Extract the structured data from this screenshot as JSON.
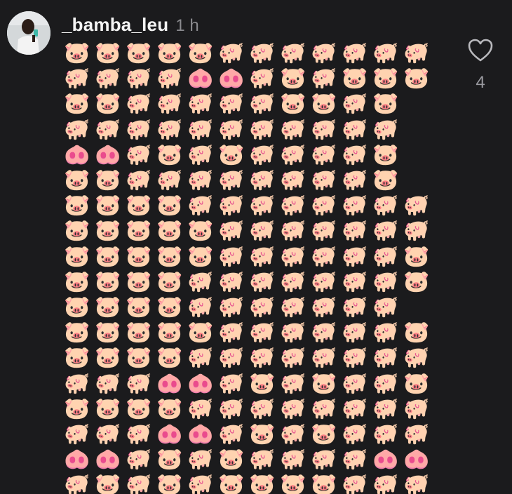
{
  "post": {
    "username": "_bamba_leu",
    "timestamp": "1 h"
  },
  "likes": {
    "count": "4",
    "icon": "heart-icon"
  },
  "emoji_legend": {
    "F": "🐷",
    "P": "🐖",
    "N": "🐽"
  },
  "emoji_rows": [
    "FFFFFPPPPPPP",
    "PPPPNNPFPFFF",
    "FFPPPPPFFPF",
    "PPPPPPPPPPP",
    "NNPFPFPPPPF",
    "FFPPPPPPPPF",
    "FFFFPPPPPPPP",
    "FFFFFPPPPPPP",
    "FFFFFPPPPPPF",
    "FFFFPPPPPPPF",
    "FFFFPPPPPPP",
    "FFFFFPPPPPPF",
    "FFFFPPPPPPPP",
    "PPPNNPFPFPPF",
    "FFFFPPPPPPPP",
    "PPPNNPFPFPPP",
    "NNPFPFPPPPNN",
    "PFPFPFFFFPPP"
  ]
}
